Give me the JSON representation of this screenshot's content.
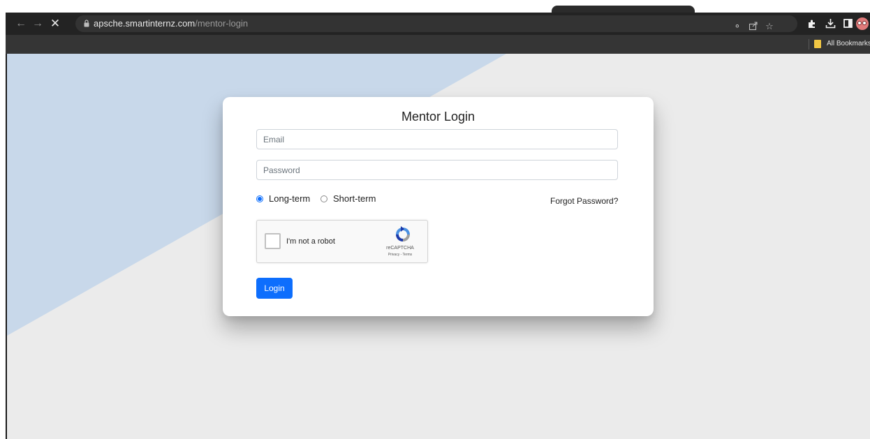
{
  "browser": {
    "address": {
      "host": "apsche.smartinternz.com",
      "path": "/mentor-login"
    },
    "bookmarks_bar": {
      "all_bookmarks_label": "All Bookmarks"
    }
  },
  "page": {
    "colors": {
      "background": "#ebebeb",
      "accent_shape": "#c8d8ea",
      "primary": "#0d6efd"
    },
    "login_card": {
      "title": "Mentor Login",
      "email_placeholder": "Email",
      "password_placeholder": "Password",
      "term_options": [
        {
          "label": "Long-term",
          "selected": true
        },
        {
          "label": "Short-term",
          "selected": false
        }
      ],
      "forgot_password_label": "Forgot Password?",
      "recaptcha": {
        "checkbox_label": "I'm not a robot",
        "brand": "reCAPTCHA",
        "links": "Privacy - Terms"
      },
      "login_button_label": "Login"
    }
  }
}
